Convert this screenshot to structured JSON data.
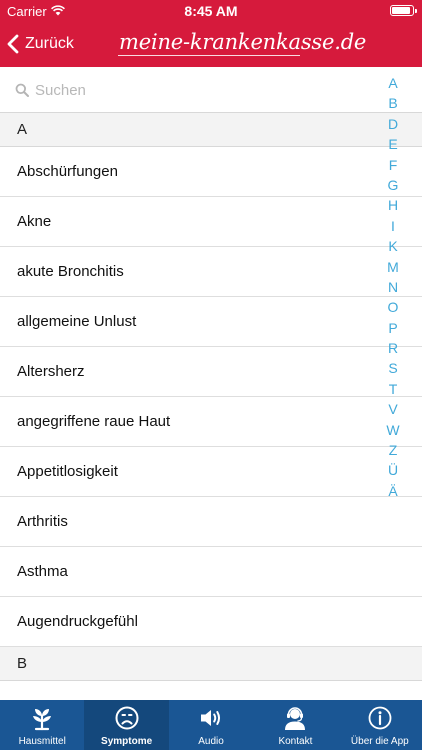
{
  "status_bar": {
    "carrier": "Carrier",
    "time": "8:45 AM",
    "battery_level": 0.9
  },
  "nav": {
    "back_label": "Zurück",
    "logo_text": "meine-krankenkasse.de"
  },
  "search": {
    "placeholder": "Suchen"
  },
  "sections": [
    {
      "letter": "A",
      "items": [
        "Abschürfungen",
        "Akne",
        "akute Bronchitis",
        "allgemeine Unlust",
        "Altersherz",
        "angegriffene raue Haut",
        "Appetitlosigkeit",
        "Arthritis",
        "Asthma",
        "Augendruckgefühl"
      ]
    },
    {
      "letter": "B",
      "items": [
        ""
      ]
    }
  ],
  "index_letters": [
    "A",
    "B",
    "D",
    "E",
    "F",
    "G",
    "H",
    "I",
    "K",
    "M",
    "N",
    "O",
    "P",
    "R",
    "S",
    "T",
    "V",
    "W",
    "Z",
    "Ü",
    "Ä"
  ],
  "tabs": [
    {
      "label": "Hausmittel",
      "icon": "plant-icon",
      "active": false
    },
    {
      "label": "Symptome",
      "icon": "sad-face-icon",
      "active": true
    },
    {
      "label": "Audio",
      "icon": "speaker-icon",
      "active": false
    },
    {
      "label": "Kontakt",
      "icon": "support-agent-icon",
      "active": false
    },
    {
      "label": "Über die App",
      "icon": "info-icon",
      "active": false
    }
  ],
  "colors": {
    "header": "#d61a3c",
    "tabbar": "#1a5694",
    "index": "#41a9d9",
    "section_bg": "#f3f3f3"
  }
}
